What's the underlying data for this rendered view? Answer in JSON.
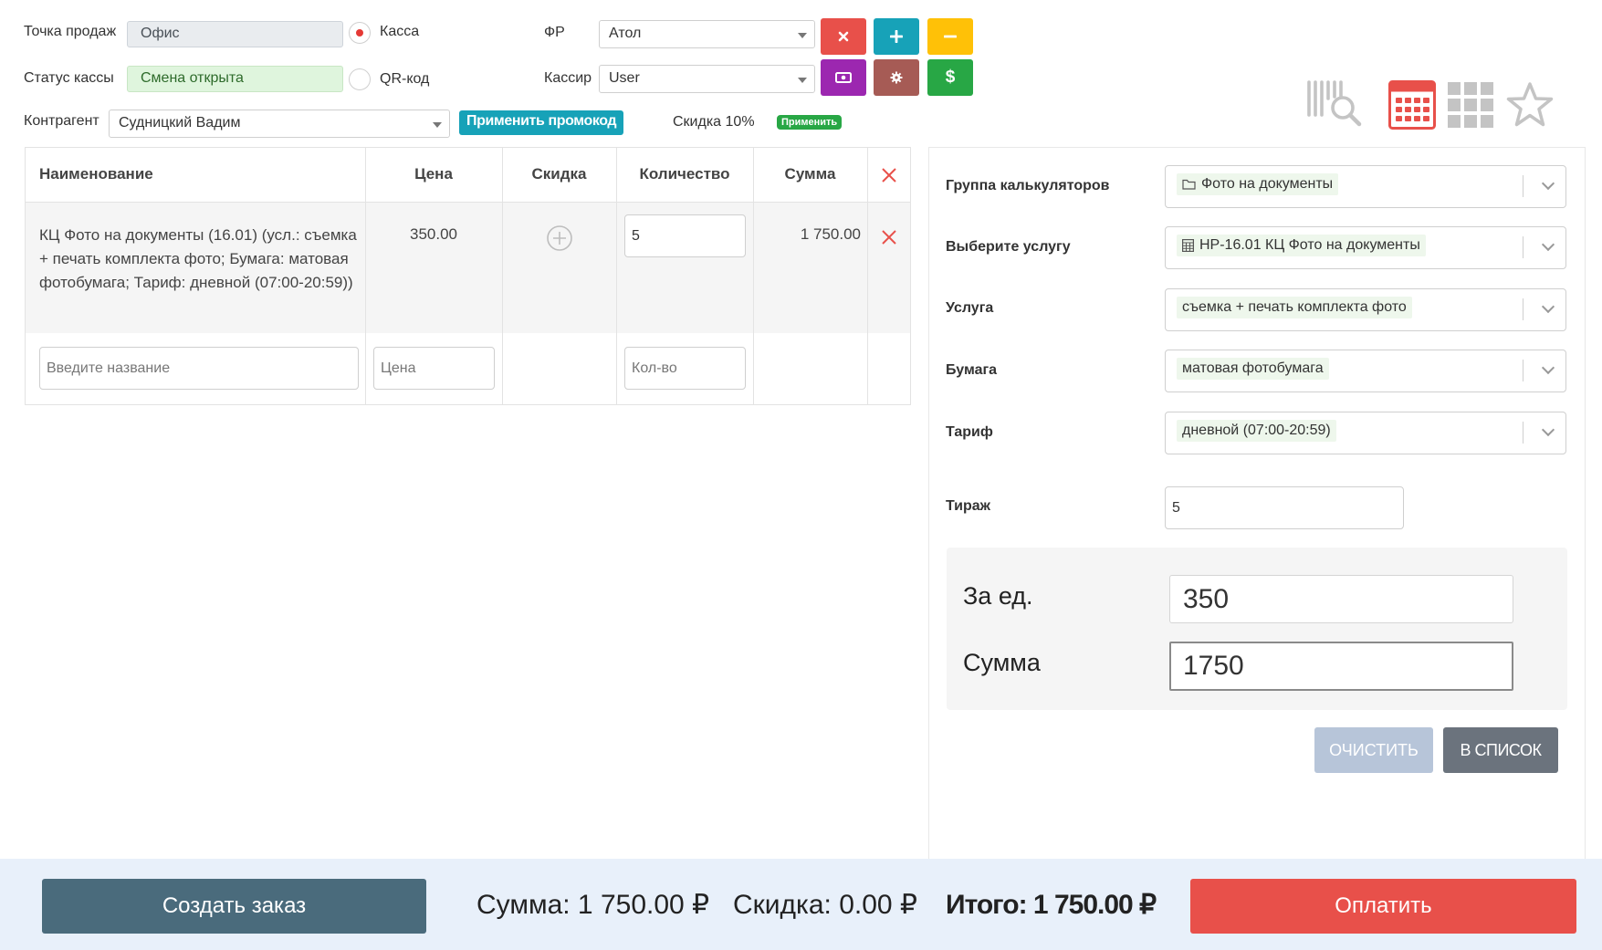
{
  "top": {
    "point_of_sale_label": "Точка продаж",
    "point_of_sale_value": "Офис",
    "cash_status_label": "Статус кассы",
    "cash_status_value": "Смена открыта",
    "radio_cash_label": "Касса",
    "radio_qr_label": "QR-код",
    "fr_label": "ФР",
    "fr_value": "Атол",
    "cashier_label": "Кассир",
    "cashier_value": "User",
    "counterparty_label": "Контрагент",
    "counterparty_value": "Судницкий Вадим",
    "promo_button": "Применить промокод",
    "discount_text": "Скидка 10%",
    "apply_badge": "Применить",
    "buttons": {
      "close_icon": "close-icon",
      "plus_icon": "plus-icon",
      "minus_icon": "minus-icon",
      "money_icon": "money-icon",
      "gear_icon": "gear-icon",
      "dollar_icon": "dollar-icon"
    },
    "colors": {
      "red": "#e8504a",
      "teal": "#17a2b8",
      "yellow": "#ffc107",
      "purple": "#9c27b0",
      "brown": "#a65b55",
      "green": "#28a745"
    }
  },
  "table": {
    "headers": [
      "Наименование",
      "Цена",
      "Скидка",
      "Количество",
      "Сумма"
    ],
    "rows": [
      {
        "name": "КЦ Фото на документы (16.01) (усл.: съемка + печать комплекта фото; Бумага: матовая фотобумага; Тариф: дневной (07:00-20:59))",
        "price": "350.00",
        "quantity": "5",
        "sum": "1 750.00"
      }
    ],
    "new_row": {
      "name_placeholder": "Введите название",
      "price_placeholder": "Цена",
      "qty_placeholder": "Кол-во"
    }
  },
  "right": {
    "group_label": "Группа калькуляторов",
    "group_value": "Фото на документы",
    "service_label": "Выберите услугу",
    "service_value": "НР-16.01 КЦ Фото на документы",
    "usluga_label": "Услуга",
    "usluga_value": "съемка + печать комплекта фото",
    "paper_label": "Бумага",
    "paper_value": "матовая фотобумага",
    "tariff_label": "Тариф",
    "tariff_value": "дневной (07:00-20:59)",
    "circulation_label": "Тираж",
    "circulation_value": "5",
    "per_unit_label": "За ед.",
    "per_unit_value": "350",
    "sum_label": "Сумма",
    "sum_value": "1750",
    "clear_button": "ОЧИСТИТЬ",
    "to_list_button": "В СПИСОК"
  },
  "footer": {
    "create_order": "Создать заказ",
    "sum_text": "Сумма: 1 750.00 ₽",
    "discount_text": "Скидка: 0.00 ₽",
    "total_text": "Итого: 1 750.00 ₽",
    "pay": "Оплатить"
  }
}
